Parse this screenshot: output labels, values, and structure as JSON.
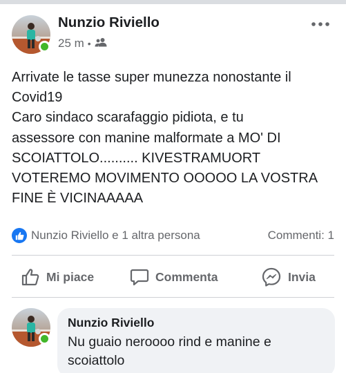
{
  "post": {
    "author": "Nunzio Riviello",
    "time": "25 m",
    "audience_icon": "friends-icon",
    "more_icon": "more-options-icon",
    "text_lines": [
      "Arrivate le tasse super munezza nonostante il",
      "Covid19",
      "Caro sindaco scarafaggio pidiota, e tu",
      "assessore con manine malformate a MO' DI",
      "SCOIATTOLO.......... KIVESTRAMUORT",
      "VOTEREMO MOVIMENTO OOOOO LA VOSTRA",
      "FINE È VICINAAAAA"
    ]
  },
  "reactions": {
    "icon": "like-reaction-icon",
    "people": "Nunzio Riviello e 1 altra persona",
    "comments": "Commenti: 1"
  },
  "actions": {
    "like": "Mi piace",
    "comment": "Commenta",
    "share": "Invia"
  },
  "comment": {
    "author": "Nunzio Riviello",
    "text_lines": [
      "Nu guaio neroooo rind e manine e",
      "scoiattolo"
    ]
  },
  "colors": {
    "brand_blue": "#1877f2",
    "online_green": "#42b72a",
    "secondary_text": "#65676b",
    "bubble_bg": "#f0f2f5"
  }
}
